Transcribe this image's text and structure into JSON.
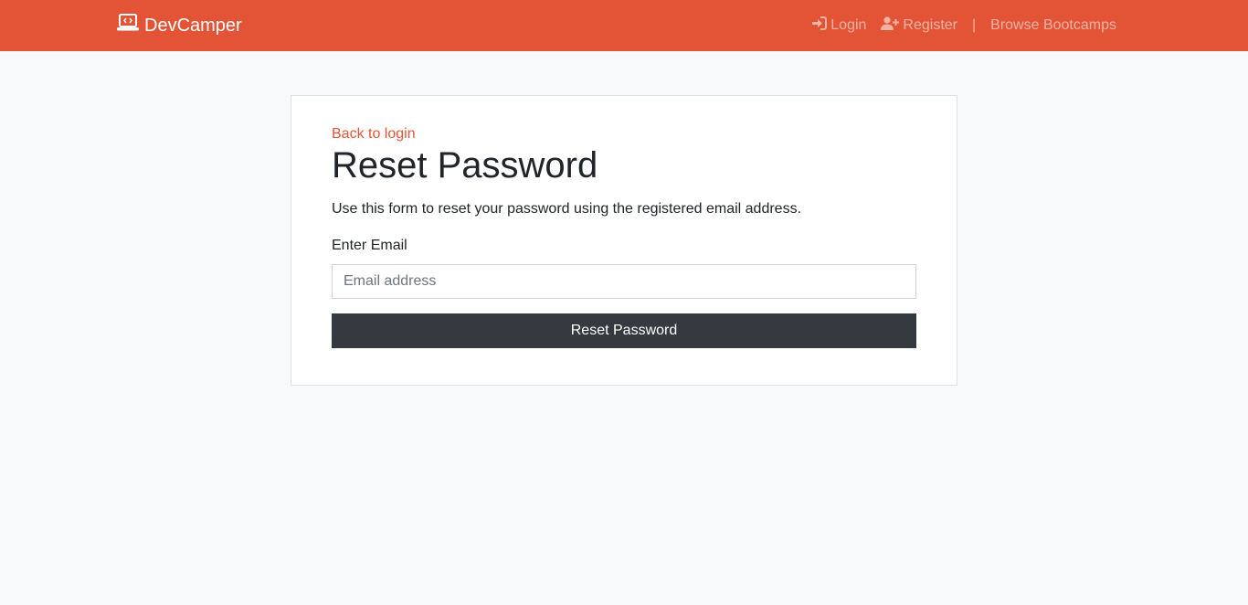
{
  "navbar": {
    "brand": "DevCamper",
    "brand_icon": "laptop-code-icon",
    "links": {
      "login": "Login",
      "register": "Register",
      "separator": "|",
      "browse": "Browse Bootcamps"
    }
  },
  "card": {
    "back_link": "Back to login",
    "title": "Reset Password",
    "description": "Use this form to reset your password using the registered email address.",
    "email_label": "Enter Email",
    "email_placeholder": "Email address",
    "email_value": "",
    "submit_label": "Reset Password"
  },
  "colors": {
    "primary": "#e25435",
    "dark": "#343a40",
    "background": "#f8f9fa"
  }
}
